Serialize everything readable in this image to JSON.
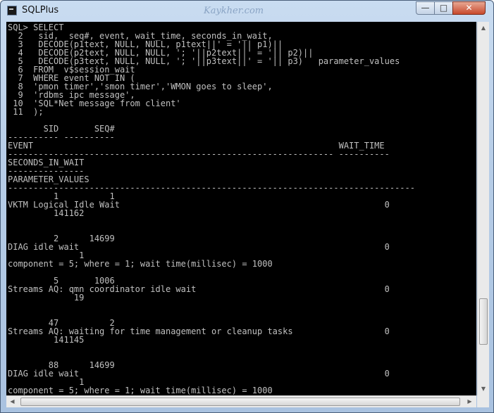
{
  "window": {
    "title": "SQLPlus",
    "watermark": "Kaykher.com",
    "controls": {
      "minimize": "—",
      "maximize": "□",
      "close": "✕"
    }
  },
  "console": {
    "lines": [
      "SQL> SELECT",
      "  2   sid,  seq#, event, wait_time, seconds_in_wait,",
      "  3   DECODE(p1text, NULL, NULL, p1text||' = '|| p1)||",
      "  4   DECODE(p2text, NULL, NULL, '; '||p2text||' = '|| p2)||",
      "  5   DECODE(p3text, NULL, NULL, '; '||p3text||' = '|| p3)   parameter_values",
      "  6  FROM  v$session_wait",
      "  7  WHERE event NOT IN (",
      "  8  'pmon timer','smon timer','WMON goes to sleep',",
      "  9  'rdbms ipc message',",
      " 10  'SQL*Net message from client'",
      " 11  );",
      "",
      "       SID       SEQ#",
      "---------- ----------",
      "EVENT                                                            WAIT_TIME",
      "---------------------------------------------------------------- ----------",
      "SECONDS_IN_WAIT",
      "---------------",
      "PARAMETER_VALUES",
      "--------------------------------------------------------------------------------",
      "         1          1",
      "VKTM Logical Idle Wait                                                    0",
      "         141162",
      "",
      "",
      "         2      14699",
      "DIAG idle wait                                                            0",
      "              1",
      "component = 5; where = 1; wait time(millisec) = 1000",
      "",
      "         5       1006",
      "Streams AQ: qmn coordinator idle wait                                     0",
      "             19",
      "",
      "",
      "        47          2",
      "Streams AQ: waiting for time management or cleanup tasks                  0",
      "         141145",
      "",
      "",
      "        88      14699",
      "DIAG idle wait                                                            0",
      "              1",
      "component = 5; where = 1; wait time(millisec) = 1000"
    ]
  },
  "scrollbars": {
    "vertical": {
      "up_icon": "▲",
      "down_icon": "▼",
      "position": 0.78
    },
    "horizontal": {
      "left_icon": "◀",
      "right_icon": "▶",
      "position": 0.0
    }
  }
}
